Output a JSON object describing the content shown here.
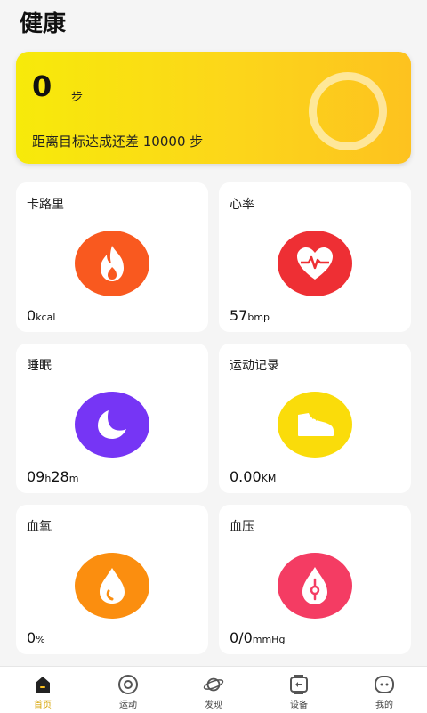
{
  "page": {
    "title": "健康"
  },
  "steps": {
    "count": "0",
    "unit": "步",
    "goal_text": "距离目标达成还差 10000 步"
  },
  "cards": {
    "calories": {
      "title": "卡路里",
      "value": "0",
      "unit": "kcal",
      "color": "#f9591f",
      "icon": "flame-icon"
    },
    "heart_rate": {
      "title": "心率",
      "value": "57",
      "unit": "bmp",
      "color": "#ee2f34",
      "icon": "heart-pulse-icon"
    },
    "sleep": {
      "title": "睡眠",
      "value_h": "09",
      "unit_h": "h",
      "value_m": "28",
      "unit_m": "m",
      "color": "#7635f5",
      "icon": "moon-icon"
    },
    "exercise": {
      "title": "运动记录",
      "value": "0.00",
      "unit": "KM",
      "color": "#fadc0a",
      "icon": "shoe-icon"
    },
    "blood_oxygen": {
      "title": "血氧",
      "value": "0",
      "unit": "%",
      "color": "#fb8e0f",
      "icon": "droplet-icon"
    },
    "blood_pressure": {
      "title": "血压",
      "value": "0/0",
      "unit": "mmHg",
      "color": "#f43c63",
      "icon": "pressure-drop-icon"
    }
  },
  "tabbar": {
    "accent": "#d6a300",
    "items": [
      {
        "label": "首页",
        "icon": "home-icon"
      },
      {
        "label": "运动",
        "icon": "target-icon"
      },
      {
        "label": "发现",
        "icon": "planet-icon"
      },
      {
        "label": "设备",
        "icon": "watch-icon"
      },
      {
        "label": "我的",
        "icon": "face-icon"
      }
    ]
  }
}
